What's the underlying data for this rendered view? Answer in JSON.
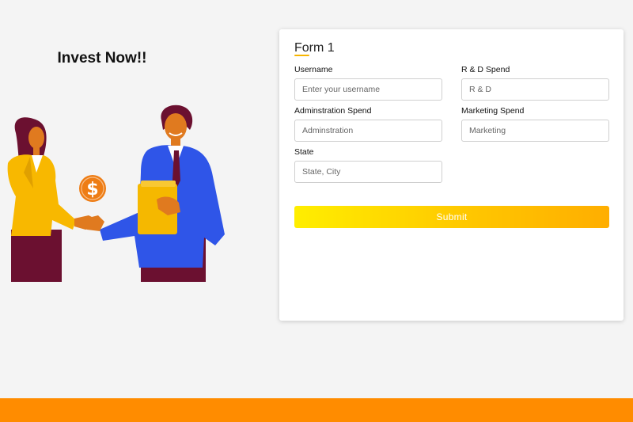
{
  "hero": {
    "title": "Invest Now!!",
    "illustration": "two-people-handshake-dollar-illustration"
  },
  "form": {
    "title": "Form 1",
    "fields": [
      {
        "label": "Username",
        "placeholder": "Enter your username",
        "value": ""
      },
      {
        "label": "R & D Spend",
        "placeholder": "R & D",
        "value": ""
      },
      {
        "label": "Adminstration Spend",
        "placeholder": "Adminstration",
        "value": ""
      },
      {
        "label": "Marketing Spend",
        "placeholder": "Marketing",
        "value": ""
      },
      {
        "label": "State",
        "placeholder": "State, City",
        "value": ""
      }
    ],
    "submit_label": "Submit"
  },
  "colors": {
    "background": "#f4f4f4",
    "footer": "#ff8c00",
    "button_gradient_start": "#ffee00",
    "button_gradient_end": "#ffae00",
    "accent_underline": "#f7b500"
  }
}
